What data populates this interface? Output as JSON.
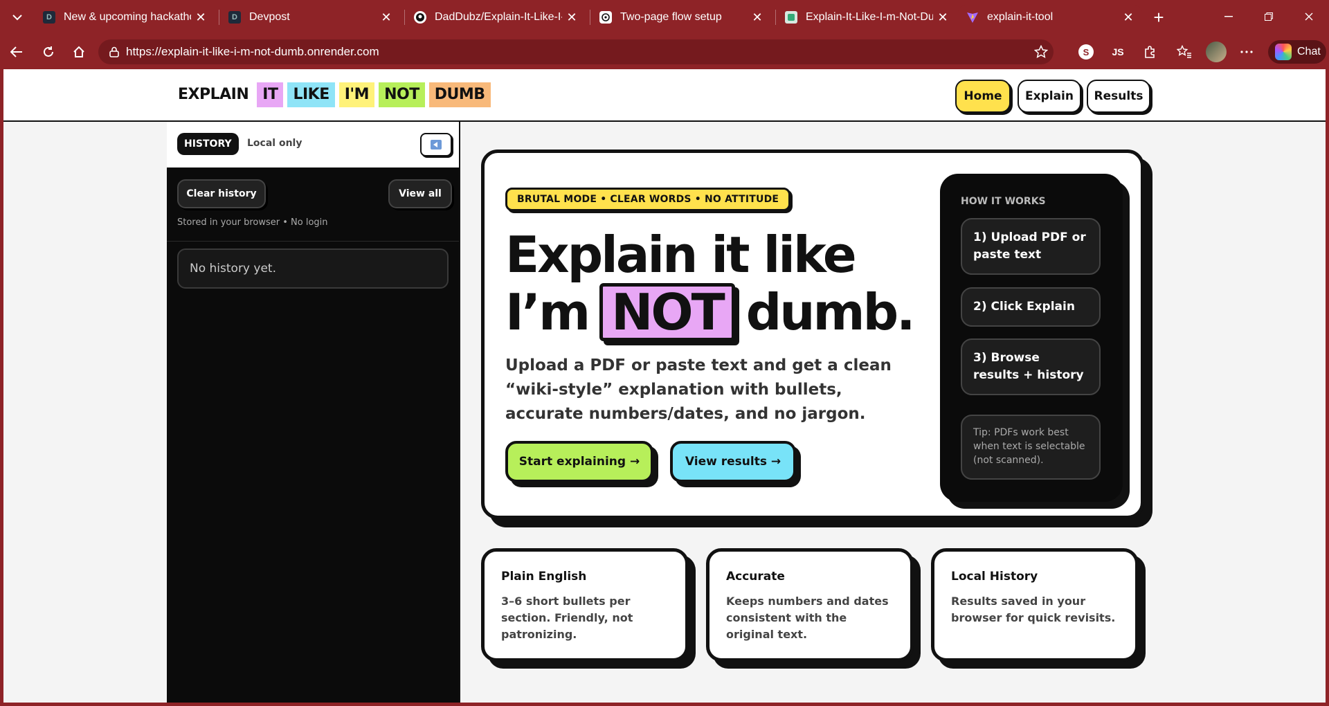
{
  "browser": {
    "tabs": [
      {
        "title": "New & upcoming hackathons",
        "favicon": "D"
      },
      {
        "title": "Devpost",
        "favicon": "D"
      },
      {
        "title": "DadDubz/Explain-It-Like-I-m-Not-Dumb",
        "favicon": "github-icon"
      },
      {
        "title": "Two-page flow setup",
        "favicon": "chatgpt-icon"
      },
      {
        "title": "Explain-It-Like-I-m-Not-Dumb",
        "favicon": "render-icon"
      },
      {
        "title": "explain-it-tool",
        "favicon": "vite-icon"
      }
    ],
    "url": "https://explain-it-like-i-m-not-dumb.onrender.com",
    "ext_s": "S",
    "ext_js": "JS",
    "chat_label": "Chat"
  },
  "site": {
    "logo_words": [
      "EXPLAIN",
      "IT",
      "LIKE",
      "I'M",
      "NOT",
      "DUMB"
    ],
    "logo_colors": [
      "#ffffff",
      "#e8a7f5",
      "#8fe4f7",
      "#fff27a",
      "#b7ef5a",
      "#f8b97a"
    ],
    "nav": {
      "home": "Home",
      "explain": "Explain",
      "results": "Results"
    }
  },
  "sidebar": {
    "pill": "HISTORY",
    "scope": "Local only",
    "clear_btn": "Clear history",
    "view_all_btn": "View all",
    "note": "Stored in your browser • No login",
    "empty": "No history yet."
  },
  "hero": {
    "badge": "BRUTAL MODE • CLEAR WORDS • NO ATTITUDE",
    "title_line1": "Explain it like",
    "title_pre": "I’m",
    "title_highlight": "NOT",
    "title_post": "dumb.",
    "lead": "Upload a PDF or paste text and get a clean “wiki-style” explanation with bullets, accurate numbers/dates, and no jargon.",
    "cta_start": "Start explaining →",
    "cta_results": "View results →"
  },
  "how_it_works": {
    "heading": "HOW IT WORKS",
    "steps": [
      "1) Upload PDF or paste text",
      "2) Click Explain",
      "3) Browse results + history"
    ],
    "tip": "Tip: PDFs work best when text is selectable (not scanned)."
  },
  "features": [
    {
      "title": "Plain English",
      "body": "3–6 short bullets per section. Friendly, not patronizing."
    },
    {
      "title": "Accurate",
      "body": "Keeps numbers and dates consistent with the original text."
    },
    {
      "title": "Local History",
      "body": "Results saved in your browser for quick revisits."
    }
  ]
}
